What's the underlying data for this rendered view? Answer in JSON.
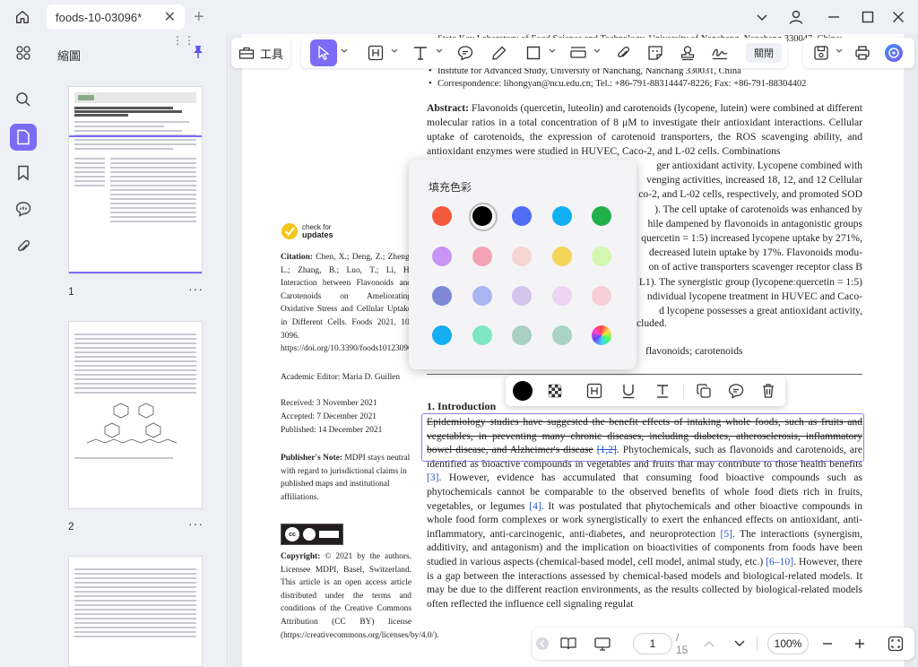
{
  "tab": {
    "title": "foods-10-03096*"
  },
  "panel": {
    "title": "縮圖",
    "page_labels": [
      "1",
      "2"
    ]
  },
  "toolbar": {
    "tools_label": "工具",
    "close_label": "關閉"
  },
  "header_lines": [
    "State Key Laboratory of Food Science and Technology, University of Nanchang, Nanchang 330047, China;",
    "Institute for Advanced Study, University of Nanchang, Nanchang 330031, China",
    "Correspondence: lihongyan@ncu.edu.cn; Tel.: +86-791-88314447-8226; Fax: +86-791-88304402"
  ],
  "abstract": {
    "label": "Abstract:",
    "text": "Flavonoids (quercetin, luteolin) and carotenoids (lycopene, lutein) were combined at different molecular ratios in a total concentration of 8 μM to investigate their antioxidant interactions. Cellular uptake of carotenoids, the expression of carotenoid transporters, the ROS scavenging ability, and antioxidant enzymes were studied in HUVEC, Caco-2, and L-02 cells. Combinations",
    "right_lines": [
      "ger antioxidant activity.  Lycopene combined with",
      "venging activities, increased 18, 12, and 12 Cellular",
      "co-2, and L-02 cells, respectively, and promoted SOD",
      ").  The cell uptake of carotenoids was enhanced by",
      "hile dampened by flavonoids in antagonistic groups",
      "quercetin = 1:5) increased lycopene uptake by 271%,",
      "decreased lutein uptake by 17%.  Flavonoids modu-",
      "on of active transporters scavenger receptor class B",
      "L1).  The synergistic group (lycopene:quercetin = 1:5)",
      "ndividual lycopene treatment in HUVEC and Caco-",
      "d lycopene possesses a great antioxidant activity,",
      "cluded."
    ],
    "keywords_tail": "flavonoids; carotenoids"
  },
  "sidebar": {
    "check_updates": [
      "check for",
      "updates"
    ],
    "citation_label": "Citation:",
    "citation": "Chen, X.; Deng, Z.; Zheng, L.; Zhang, B.; Luo, T.; Li, H. Interaction between Flavonoids and Carotenoids on Ameliorating Oxidative Stress and Cellular Uptake in Different Cells. Foods 2021, 10, 3096. https://doi.org/10.3390/foods10123096",
    "editor": "Academic Editor: Maria D. Guillen",
    "received": "Received: 3 November 2021",
    "accepted": "Accepted: 7 December 2021",
    "published": "Published: 14 December 2021",
    "publisher_label": "Publisher's Note:",
    "publisher_note": "MDPI stays neutral with regard to jurisdictional claims in published maps and institutional affiliations.",
    "copyright_label": "Copyright:",
    "copyright": "© 2021 by the authors. Licensee MDPI, Basel, Switzerland. This article is an open access article distributed under the terms and conditions of the Creative Commons Attribution (CC BY) license (https://creativecommons.org/licenses/by/4.0/)."
  },
  "intro": {
    "heading": "1. Introduction",
    "struck": "Epidemiology studies have suggested the benefit effects of intaking whole foods, such as fruits and vegetables, in preventing many chronic diseases, including diabetes, atherosclerosis, inflammatory bowel disease, and Alzheimer's disease",
    "struck_cite": "[1,2]",
    "body1": ". Phytochemicals, such as flavonoids and carotenoids, are identified as bioactive compounds in vegetables and fruits that may contribute to those health benefits ",
    "cite3": "[3]",
    "body2": ". However, evidence has accumulated that consuming food bioactive compounds such as phytochemicals cannot be comparable to the observed benefits of whole food diets rich in fruits, vegetables, or legumes ",
    "cite4": "[4]",
    "body3": ".  It was postulated that phytochemicals and other bioactive compounds in whole food form complexes or work synergistically to exert the enhanced effects on antioxidant, anti-inflammatory, anti-carcinogenic, anti-diabetes, and neuroprotection ",
    "cite5": "[5]",
    "body4": ". The interactions (synergism, additivity, and antagonism) and the implication on bioactivities of components from foods have been studied in various aspects (chemical-based model, cell model, animal study, etc.) ",
    "cite6": "[6–10]",
    "body5": ". However, there is a gap between the interactions assessed by chemical-based models and biological-related models. It may be due to the different reaction environments, as the results collected by biological-related models often reflected the influence",
    "body6": "cell signaling regulat"
  },
  "picker": {
    "title": "填充色彩",
    "colors": [
      [
        "#f4593b",
        "#000000",
        "#4f6df5",
        "#11b0f2",
        "#22b04c"
      ],
      [
        "#c994f5",
        "#f3a3b4",
        "#f5d5d2",
        "#f5d45a",
        "#d4f7b0"
      ],
      [
        "#7e87d6",
        "#aab6f3",
        "#d4c4ee",
        "#ecd4f5",
        "#f7cfd6"
      ],
      [
        "#14aef3",
        "#7ee6c0",
        "#a9d0c2",
        "#a9d4c4",
        "rainbow"
      ]
    ],
    "selected": "#000000"
  },
  "annotation_bar": {
    "fill": "#000000"
  },
  "bottombar": {
    "page": "1",
    "total": "/ 15",
    "zoom": "100%"
  }
}
